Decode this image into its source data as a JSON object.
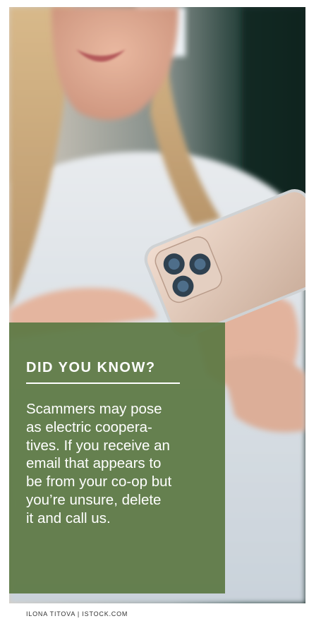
{
  "photo": {
    "alt_subject": "woman-holding-smartphone"
  },
  "callout": {
    "heading": "DID YOU KNOW?",
    "body": "Scammers may pose\nas electric coopera-\ntives. If you receive an\nemail that appears to\nbe from your co-op but\nyou’re unsure, delete\nit and call us.",
    "background_color": "#5c7844"
  },
  "credit": {
    "text": "ILONA TITOVA | ISTOCK.COM"
  }
}
